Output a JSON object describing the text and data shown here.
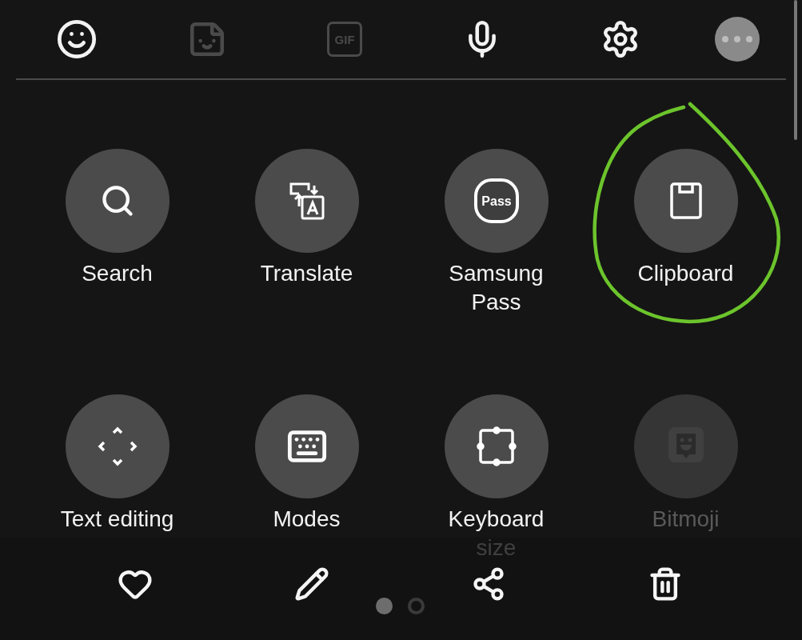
{
  "toolbar": [
    {
      "kind": "emoji",
      "disabled": false
    },
    {
      "kind": "sticker",
      "disabled": true
    },
    {
      "kind": "gif",
      "label": "GIF",
      "disabled": true
    },
    {
      "kind": "voice",
      "disabled": false
    },
    {
      "kind": "settings",
      "disabled": false
    },
    {
      "kind": "more",
      "disabled": false
    }
  ],
  "tools": [
    {
      "kind": "search",
      "label": "Search",
      "disabled": false,
      "circled": false
    },
    {
      "kind": "translate",
      "label": "Translate",
      "disabled": false,
      "circled": false
    },
    {
      "kind": "pass",
      "label": "Samsung Pass",
      "badge": "Pass",
      "disabled": false,
      "circled": false
    },
    {
      "kind": "clipboard",
      "label": "Clipboard",
      "disabled": false,
      "circled": true
    },
    {
      "kind": "text-editing",
      "label": "Text editing",
      "disabled": false,
      "circled": false
    },
    {
      "kind": "modes",
      "label": "Modes",
      "disabled": false,
      "circled": false
    },
    {
      "kind": "keyboard-size",
      "label": "Keyboard size",
      "disabled": false,
      "circled": false
    },
    {
      "kind": "bitmoji",
      "label": "Bitmoji",
      "disabled": true,
      "circled": false
    }
  ],
  "actions": [
    {
      "kind": "favorite"
    },
    {
      "kind": "edit"
    },
    {
      "kind": "share"
    },
    {
      "kind": "delete"
    }
  ],
  "pages": [
    {
      "selected": true
    },
    {
      "selected": false
    }
  ]
}
